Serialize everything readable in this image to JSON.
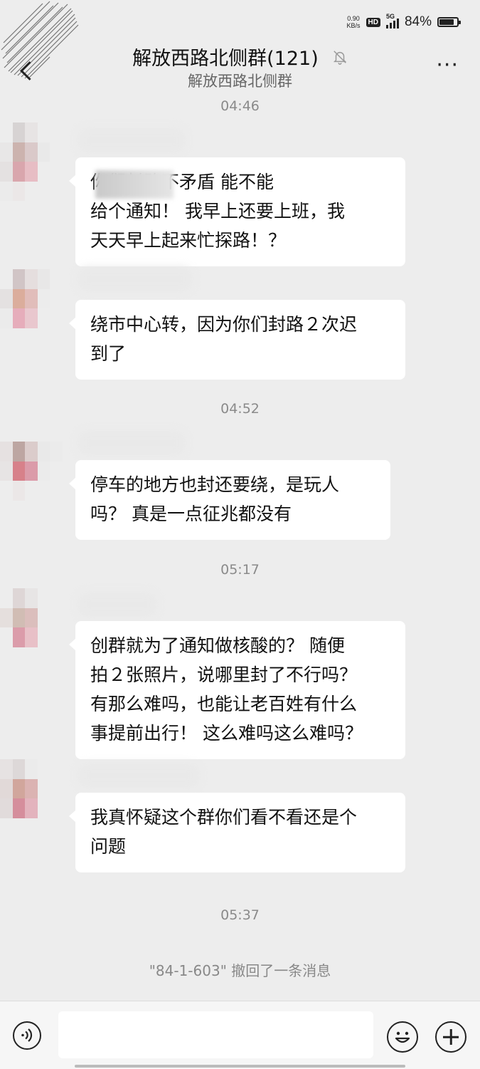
{
  "status_bar": {
    "net_speed_value": "0.90",
    "net_speed_unit": "KB/s",
    "hd_label": "HD",
    "network_label": "5G",
    "battery_percent": "84%",
    "battery_level": 0.84
  },
  "header": {
    "title": "解放西路北侧群(121)",
    "subtitle": "解放西路北侧群",
    "more_label": "···",
    "mute_icon": "bell-off-icon",
    "back_icon": "chevron-left-icon"
  },
  "messages": [
    {
      "time": "04:46",
      "text": "你们封路不矛盾 能不能\n给个通知！ 我早上还要上班，我\n天天早上起来忙探路！？"
    },
    {
      "text": "绕市中心转，因为你们封路２次迟\n到了"
    },
    {
      "time": "04:52",
      "text": "停车的地方也封还要绕，是玩人\n吗？ 真是一点征兆都没有"
    },
    {
      "time": "05:17",
      "text": "创群就为了通知做核酸的？ 随便\n拍２张照片，说哪里封了不行吗？\n有那么难吗，也能让老百姓有什么\n事提前出行！ 这么难吗这么难吗？"
    },
    {
      "text": "我真怀疑这个群你们看不看还是个\n问题"
    }
  ],
  "time_final": "05:37",
  "system_message": "\"84-1-603\" 撤回了一条消息",
  "input_bar": {
    "voice_icon": "voice-icon",
    "emoji_icon": "emoji-icon",
    "plus_icon": "plus-icon",
    "input_value": ""
  },
  "colors": {
    "background": "#ededed",
    "bubble": "#ffffff",
    "timestamp": "#8a8a8a"
  }
}
